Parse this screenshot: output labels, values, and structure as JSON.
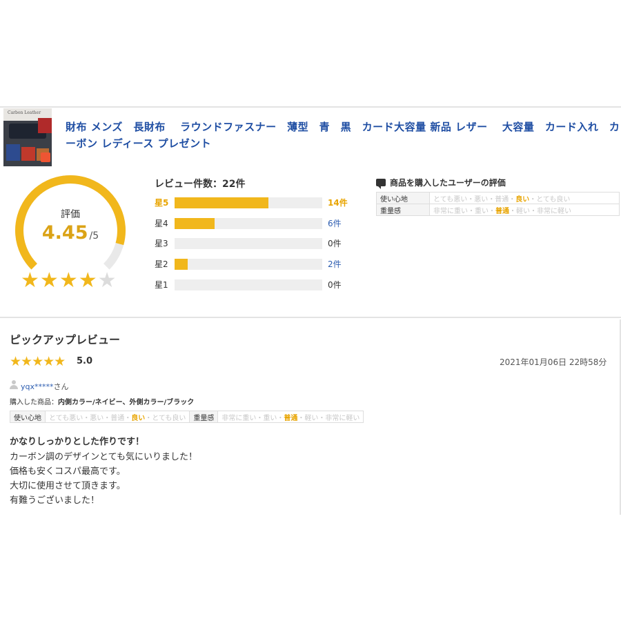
{
  "product": {
    "title": "財布 メンズ　長財布　 ラウンドファスナー　薄型　青　黒　カード大容量 新品 レザー　 大容量　カード入れ　カーボン レディース プレゼント",
    "thumb_alt": "Carbon Leather"
  },
  "rating": {
    "label": "評価",
    "value": "4.45",
    "suffix": "/5",
    "value_fraction": 0.89,
    "stars_filled": 4,
    "stars_total": 5,
    "colors": {
      "accent": "#f1b71c",
      "track": "#e9e9e9",
      "number": "#dba317"
    }
  },
  "histogram": {
    "title": "レビュー件数：22件",
    "rows": [
      {
        "label": "星5",
        "count": "14件",
        "value": 14,
        "max": 22
      },
      {
        "label": "星4",
        "count": "6件",
        "value": 6,
        "max": 22
      },
      {
        "label": "星3",
        "count": "0件",
        "value": 0,
        "max": 22
      },
      {
        "label": "星2",
        "count": "2件",
        "value": 2,
        "max": 22
      },
      {
        "label": "星1",
        "count": "0件",
        "value": 0,
        "max": 22
      }
    ]
  },
  "user_eval": {
    "title": "商品を購入したユーザーの評価",
    "icon": "speech-bubble-icon",
    "rows": [
      {
        "key": "使い心地",
        "options": [
          "とても悪い",
          "悪い",
          "普通",
          "良い",
          "とても良い"
        ],
        "selected": "良い"
      },
      {
        "key": "重量感",
        "options": [
          "非常に重い",
          "重い",
          "普通",
          "軽い",
          "非常に軽い"
        ],
        "selected": "普通"
      }
    ]
  },
  "pickup": {
    "title": "ピックアップレビュー",
    "review": {
      "stars": "★★★★★",
      "score": "5.0",
      "date": "2021年01月06日 22時58分",
      "user": "yqx*****",
      "user_suffix": "さん",
      "purchased_label": "購入した商品：",
      "purchased_value": "内側カラー/ネイビー、外側カラー/ブラック",
      "eval": {
        "k1": "使い心地",
        "k2": "重量感"
      },
      "headline": "かなりしっかりとした作りです！",
      "lines": [
        "カーボン調のデザインとても気にいりました！",
        "価格も安くコスパ最高です。",
        "大切に使用させて頂きます。",
        "有難うございました！"
      ]
    }
  }
}
